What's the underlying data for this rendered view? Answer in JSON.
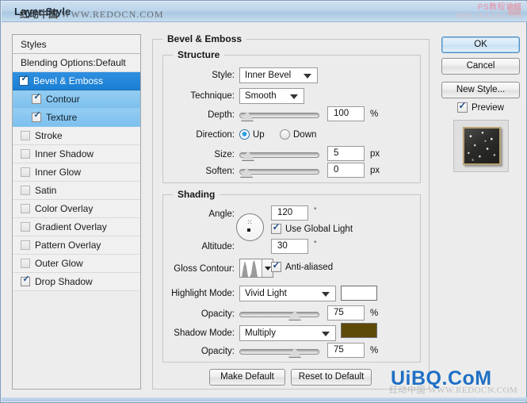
{
  "window": {
    "title": "Layer Style",
    "watermark_title_cjk": "红动中国",
    "watermark_title_url": "WWW.REDOCN.COM",
    "watermark_topright_line1": "PS教程论坛",
    "watermark_topright_line2": "BBS.16XX8.COM",
    "watermark_bottom": "UiBQ.CoM",
    "watermark_bottom_ghost": "红动中国 WWW.REDOCN.COM"
  },
  "styles_panel": {
    "header": "Styles",
    "items": [
      {
        "label": "Blending Options:Default",
        "checkbox": "none",
        "state": "normal",
        "indent": false
      },
      {
        "label": "Bevel & Emboss",
        "checkbox": "checked",
        "state": "selected",
        "indent": false
      },
      {
        "label": "Contour",
        "checkbox": "checked",
        "state": "subselected",
        "indent": true
      },
      {
        "label": "Texture",
        "checkbox": "checked",
        "state": "subselected",
        "indent": true
      },
      {
        "label": "Stroke",
        "checkbox": "unchecked",
        "state": "normal",
        "indent": false
      },
      {
        "label": "Inner Shadow",
        "checkbox": "unchecked",
        "state": "normal",
        "indent": false
      },
      {
        "label": "Inner Glow",
        "checkbox": "unchecked",
        "state": "normal",
        "indent": false
      },
      {
        "label": "Satin",
        "checkbox": "unchecked",
        "state": "normal",
        "indent": false
      },
      {
        "label": "Color Overlay",
        "checkbox": "unchecked",
        "state": "normal",
        "indent": false
      },
      {
        "label": "Gradient Overlay",
        "checkbox": "unchecked",
        "state": "normal",
        "indent": false
      },
      {
        "label": "Pattern Overlay",
        "checkbox": "unchecked",
        "state": "normal",
        "indent": false
      },
      {
        "label": "Outer Glow",
        "checkbox": "unchecked",
        "state": "normal",
        "indent": false
      },
      {
        "label": "Drop Shadow",
        "checkbox": "checked",
        "state": "normal",
        "indent": false
      }
    ]
  },
  "bevel": {
    "legend": "Bevel & Emboss",
    "structure": {
      "legend": "Structure",
      "style_label": "Style:",
      "style_value": "Inner Bevel",
      "technique_label": "Technique:",
      "technique_value": "Smooth",
      "depth_label": "Depth:",
      "depth_value": "100",
      "depth_unit": "%",
      "depth_slider_pct": 2,
      "direction_label": "Direction:",
      "direction_up": "Up",
      "direction_down": "Down",
      "direction_selected": "Up",
      "size_label": "Size:",
      "size_value": "5",
      "size_unit": "px",
      "size_slider_pct": 4,
      "soften_label": "Soften:",
      "soften_value": "0",
      "soften_unit": "px",
      "soften_slider_pct": 1
    },
    "shading": {
      "legend": "Shading",
      "angle_label": "Angle:",
      "angle_value": "120",
      "angle_degree": "°",
      "use_global_light": "Use Global Light",
      "use_global_light_checked": true,
      "altitude_label": "Altitude:",
      "altitude_value": "30",
      "altitude_degree": "°",
      "gloss_contour_label": "Gloss Contour:",
      "gloss_contour_preset": "Ring - Double",
      "anti_aliased": "Anti-aliased",
      "anti_aliased_checked": true,
      "highlight_mode_label": "Highlight Mode:",
      "highlight_mode_value": "Vivid Light",
      "highlight_color": "#ffffff",
      "highlight_opacity_label": "Opacity:",
      "highlight_opacity_value": "75",
      "highlight_opacity_unit": "%",
      "highlight_opacity_pct": 73,
      "shadow_mode_label": "Shadow Mode:",
      "shadow_mode_value": "Multiply",
      "shadow_color": "#5d4a08",
      "shadow_opacity_label": "Opacity:",
      "shadow_opacity_value": "75",
      "shadow_opacity_unit": "%",
      "shadow_opacity_pct": 73
    }
  },
  "buttons": {
    "ok": "OK",
    "cancel": "Cancel",
    "new_style": "New Style...",
    "preview": "Preview",
    "preview_checked": true,
    "make_default": "Make Default",
    "reset_to_default": "Reset to Default"
  }
}
